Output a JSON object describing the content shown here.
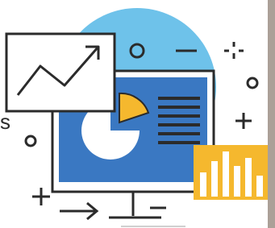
{
  "illustration": {
    "stray_text": "s",
    "colors": {
      "background": "#ffffff",
      "circle": "#6ec2ea",
      "screen": "#3a78c2",
      "stroke": "#2b2b2b",
      "pie": "#ffffff",
      "pie_slice": "#f5b82e",
      "bars_panel": "#f5b82e",
      "right_edge_photo": "#9a8f88"
    },
    "icons": [
      "line-chart-card-icon",
      "monitor-presentation-icon",
      "pie-chart-icon",
      "document-lines-icon",
      "bar-chart-panel-icon",
      "small-circle-icon",
      "plus-icon",
      "minus-icon",
      "arrow-right-icon",
      "sparkle-icon"
    ]
  }
}
